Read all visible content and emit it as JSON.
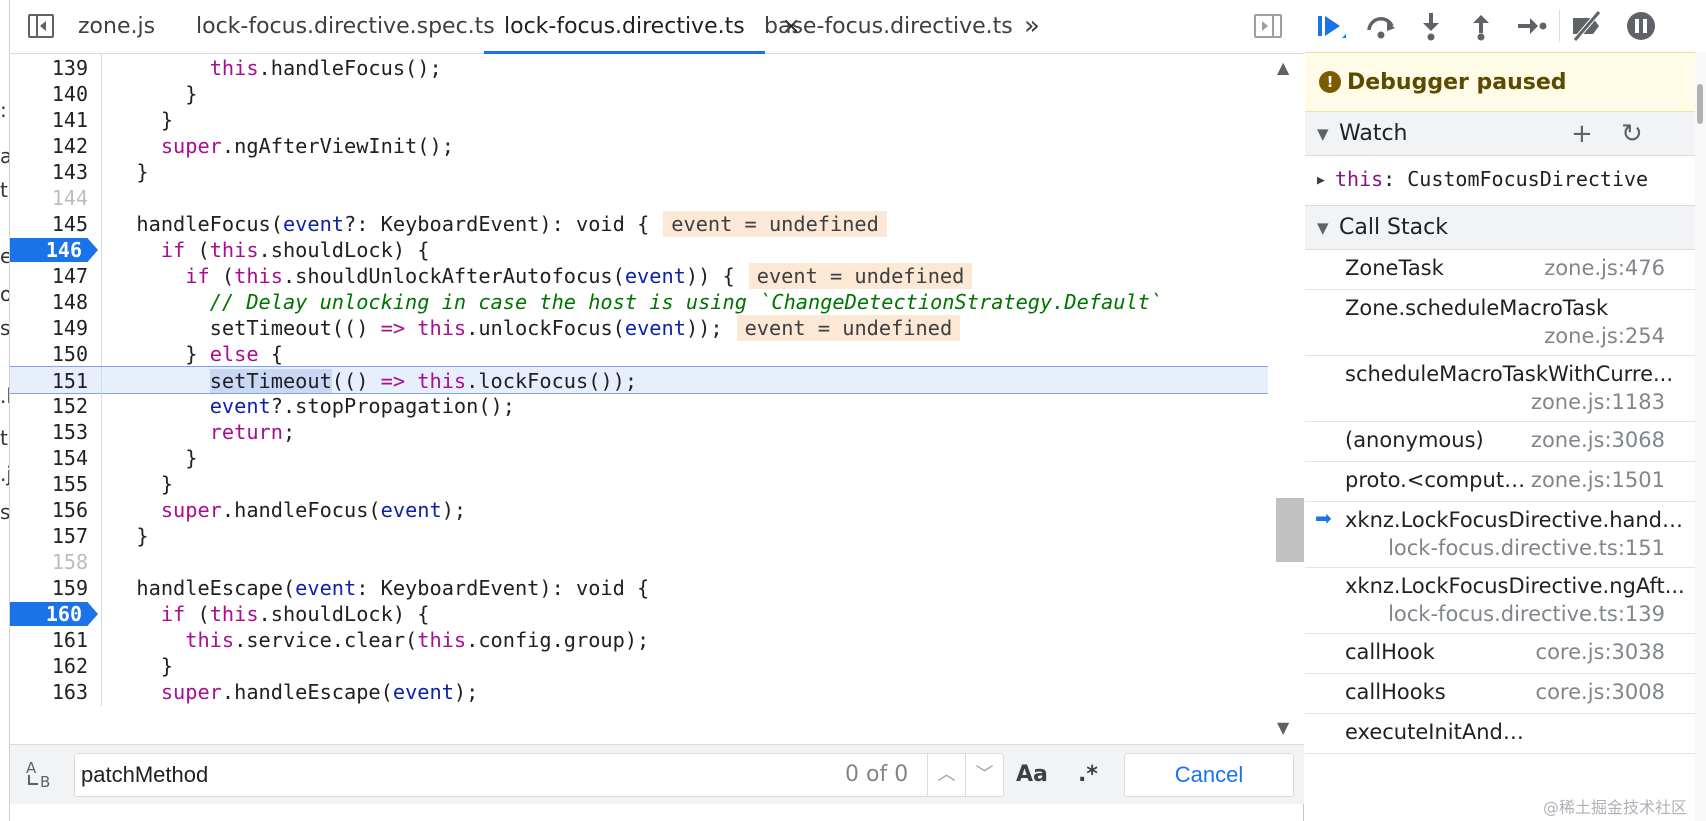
{
  "left_strip": [
    ":",
    "a_",
    "t",
    "e",
    "o",
    "s",
    ".l",
    "t",
    ".j",
    "s"
  ],
  "tabs": [
    {
      "label": "zone.js",
      "active": false
    },
    {
      "label": "lock-focus.directive.spec.ts",
      "active": false
    },
    {
      "label": "lock-focus.directive.ts",
      "active": true
    },
    {
      "label": "base-focus.directive.ts",
      "active": false
    }
  ],
  "tab_icons": {
    "toggle_navigator": "sidebar-toggle-icon",
    "more_tabs": "double-chevron-right",
    "close": "×",
    "toggle_debugger": "sidebar-right-icon"
  },
  "code": {
    "lines": [
      {
        "n": "139",
        "text": "        this.handleFocus();"
      },
      {
        "n": "140",
        "text": "      }"
      },
      {
        "n": "141",
        "text": "    }"
      },
      {
        "n": "142",
        "text": "    super.ngAfterViewInit();"
      },
      {
        "n": "143",
        "text": "  }"
      },
      {
        "n": "144",
        "text": ""
      },
      {
        "n": "145",
        "text": "  handleFocus(event?: KeyboardEvent): void {",
        "eval": "event = undefined"
      },
      {
        "n": "146",
        "text": "    if (this.shouldLock) {",
        "breakpoint": true
      },
      {
        "n": "147",
        "text": "      if (this.shouldUnlockAfterAutofocus(event)) {",
        "eval": "event = undefined"
      },
      {
        "n": "148",
        "text": "        // Delay unlocking in case the host is using `ChangeDetectionStrategy.Default`",
        "comment": true
      },
      {
        "n": "149",
        "text": "        setTimeout(() => this.unlockFocus(event));",
        "eval": "event = undefined"
      },
      {
        "n": "150",
        "text": "      } else {"
      },
      {
        "n": "151",
        "text": "        setTimeout(() => this.lockFocus());",
        "execution": true,
        "highlight": "setTimeout"
      },
      {
        "n": "152",
        "text": "        event?.stopPropagation();"
      },
      {
        "n": "153",
        "text": "        return;"
      },
      {
        "n": "154",
        "text": "      }"
      },
      {
        "n": "155",
        "text": "    }"
      },
      {
        "n": "156",
        "text": "    super.handleFocus(event);"
      },
      {
        "n": "157",
        "text": "  }"
      },
      {
        "n": "158",
        "text": ""
      },
      {
        "n": "159",
        "text": "  handleEscape(event: KeyboardEvent): void {"
      },
      {
        "n": "160",
        "text": "    if (this.shouldLock) {",
        "breakpoint": true
      },
      {
        "n": "161",
        "text": "      this.service.clear(this.config.group);"
      },
      {
        "n": "162",
        "text": "    }"
      },
      {
        "n": "163",
        "text": "    super.handleEscape(event);"
      }
    ]
  },
  "search": {
    "value": "patchMethod",
    "count": "0 of 0",
    "prev_icon": "chevron-up",
    "next_icon": "chevron-down",
    "match_case_label": "Aa",
    "regex_label": ".*",
    "cancel_label": "Cancel",
    "replace_icon": "replace-icon"
  },
  "debugger": {
    "toolbar": [
      "resume",
      "step-over",
      "step-into",
      "step-out",
      "step",
      "deactivate-breakpoints",
      "pause-on-exceptions"
    ],
    "paused_label": "Debugger paused",
    "paused_icon": "!",
    "watch": {
      "title": "Watch",
      "add_icon": "+",
      "refresh_icon": "↻",
      "expression": "this",
      "value": "CustomFocusDirective"
    },
    "callstack": {
      "title": "Call Stack",
      "frames": [
        {
          "fn": "ZoneTask",
          "loc": "zone.js:476"
        },
        {
          "fn": "Zone.scheduleMacroTask",
          "loc": "zone.js:254"
        },
        {
          "fn": "scheduleMacroTaskWithCurre...",
          "loc": "zone.js:1183"
        },
        {
          "fn": "(anonymous)",
          "loc": "zone.js:3068"
        },
        {
          "fn": "proto.<computed>",
          "loc": "zone.js:1501"
        },
        {
          "fn": "xknz.LockFocusDirective.handl...",
          "loc": "lock-focus.directive.ts:151",
          "current": true
        },
        {
          "fn": "xknz.LockFocusDirective.ngAft...",
          "loc": "lock-focus.directive.ts:139"
        },
        {
          "fn": "callHook",
          "loc": "core.js:3038"
        },
        {
          "fn": "callHooks",
          "loc": "core.js:3008"
        },
        {
          "fn": "executeInitAndCheckHooks",
          "loc": ""
        }
      ]
    }
  },
  "watermark": "@稀土掘金技术社区"
}
